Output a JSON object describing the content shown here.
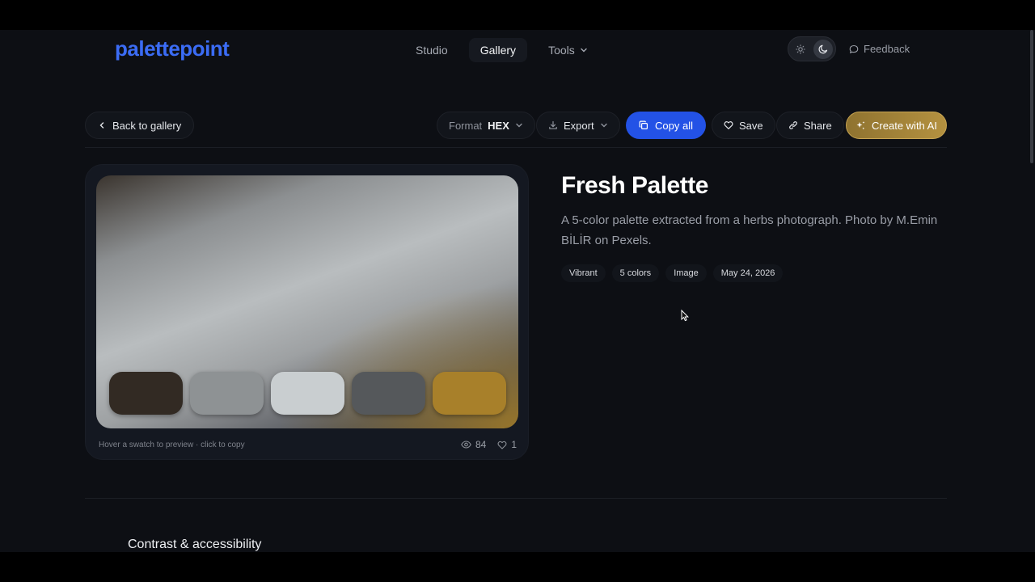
{
  "brand": {
    "logo": "palettepoint",
    "color": "#3b6cf5"
  },
  "nav": {
    "items": [
      {
        "label": "Studio"
      },
      {
        "label": "Gallery"
      },
      {
        "label": "Tools"
      }
    ]
  },
  "header": {
    "feedback_label": "Feedback"
  },
  "toolbar": {
    "back_label": "Back to gallery",
    "format_label": "Format",
    "format_value": "HEX",
    "export_label": "Export",
    "copy_all_label": "Copy all",
    "save_label": "Save",
    "share_label": "Share",
    "ai_label": "Create with AI"
  },
  "palette": {
    "title": "Fresh Palette",
    "description": "A 5-color palette extracted from a herbs photograph. Photo by M.Emin BİLİR on Pexels.",
    "tags": [
      "Vibrant",
      "5 colors",
      "Image",
      "May 24, 2026"
    ],
    "swatches": [
      "#322a23",
      "#8e9294",
      "#c9ced0",
      "#55585b",
      "#a8802a"
    ],
    "hint": "Hover a swatch to preview · click to copy",
    "views": "84",
    "likes": "1"
  },
  "section": {
    "title": "Contrast & accessibility"
  }
}
